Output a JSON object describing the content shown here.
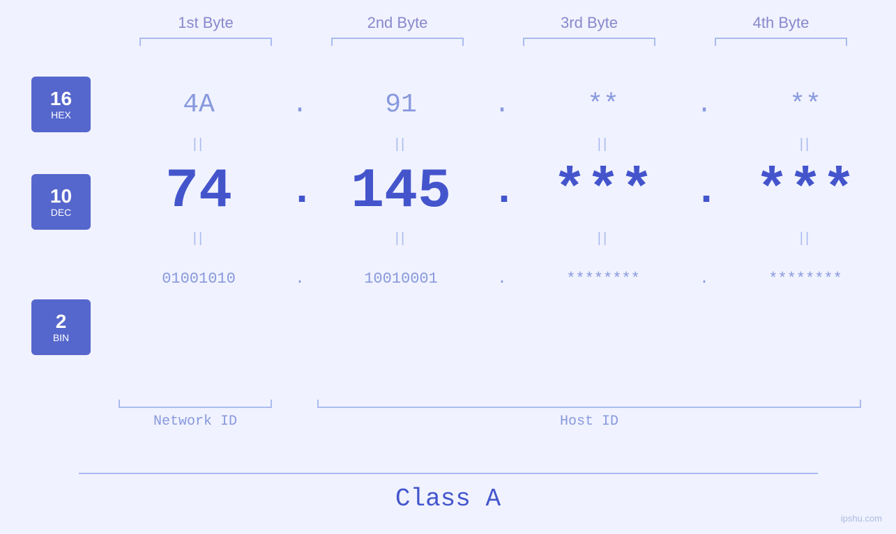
{
  "header": {
    "byte1": "1st Byte",
    "byte2": "2nd Byte",
    "byte3": "3rd Byte",
    "byte4": "4th Byte"
  },
  "badges": {
    "hex": {
      "number": "16",
      "label": "HEX"
    },
    "dec": {
      "number": "10",
      "label": "DEC"
    },
    "bin": {
      "number": "2",
      "label": "BIN"
    }
  },
  "hex_row": {
    "val1": "4A",
    "val2": "91",
    "val3": "**",
    "val4": "**",
    "dot": "."
  },
  "dec_row": {
    "val1": "74",
    "val2": "145.",
    "val3": "***",
    "val4": "***",
    "dot1": ".",
    "dot2": ".",
    "dot3": "."
  },
  "bin_row": {
    "val1": "01001010",
    "val2": "10010001",
    "val3": "********",
    "val4": "********",
    "dot": "."
  },
  "labels": {
    "network_id": "Network ID",
    "host_id": "Host ID",
    "class": "Class A"
  },
  "watermark": "ipshu.com",
  "colors": {
    "accent": "#4455cc",
    "light": "#8899dd",
    "bracket": "#aabbee",
    "badge_bg": "#5566cc",
    "bg": "#f0f2ff"
  }
}
